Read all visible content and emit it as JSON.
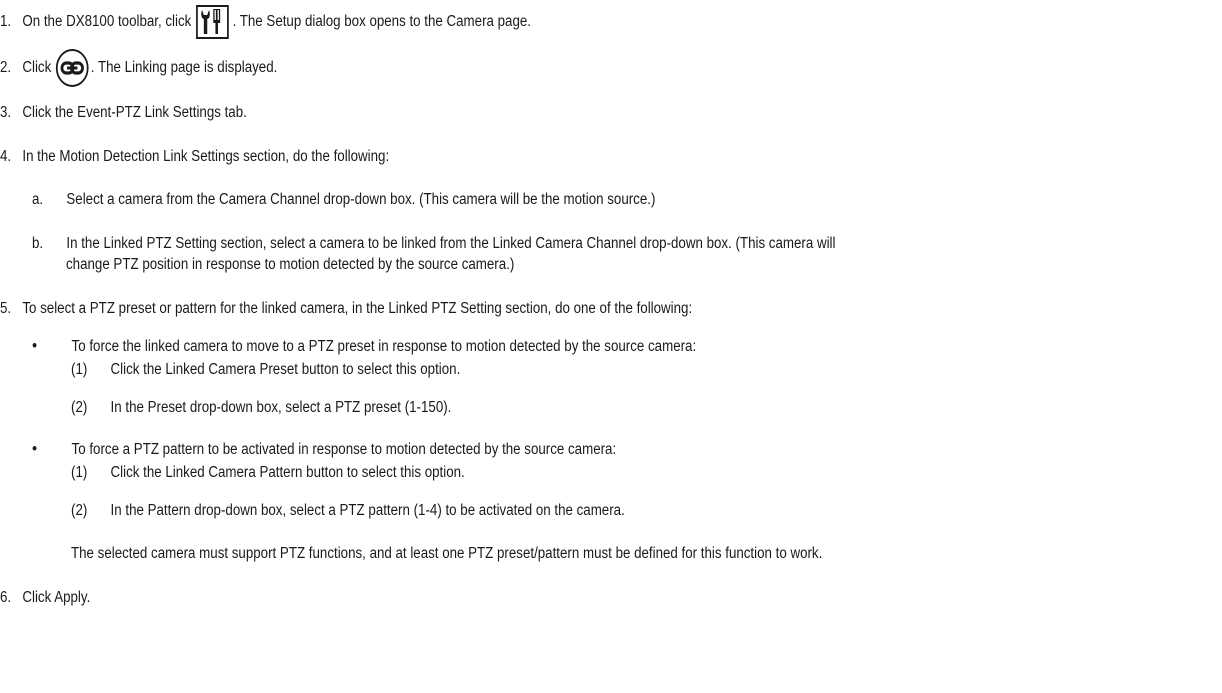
{
  "steps": [
    {
      "num": "1.",
      "before": "On the DX8100 toolbar, click",
      "icon": "tools-icon",
      "after": ". The Setup dialog box opens to the Camera page."
    },
    {
      "num": "2.",
      "before": "Click",
      "icon": "link-icon",
      "after": ". The Linking page is displayed."
    },
    {
      "num": "3.",
      "text": "Click the Event-PTZ Link Settings tab."
    },
    {
      "num": "4.",
      "text": "In the Motion Detection Link Settings section, do the following:"
    },
    {
      "num": "5.",
      "text": "To select a PTZ preset or pattern for the linked camera, in the Linked PTZ Setting section, do one of the following:"
    },
    {
      "num": "6.",
      "text": "Click Apply."
    }
  ],
  "substeps": [
    {
      "label": "a.",
      "text": "Select a camera from the Camera Channel drop-down box. (This camera will be the motion source.)"
    },
    {
      "label": "b.",
      "line1": "In the Linked PTZ Setting section, select a camera to be linked from the Linked Camera Channel drop-down box. (This camera will",
      "line2": "change PTZ position in response to motion detected by the source camera.)"
    }
  ],
  "bullets": [
    {
      "marker": "•",
      "text": "To force the linked camera to move to a PTZ preset in response to motion detected by the source camera:",
      "items": [
        {
          "label": "(1)",
          "text": "Click the Linked Camera Preset button to select this option."
        },
        {
          "label": "(2)",
          "text": "In the Preset drop-down box, select a PTZ preset (1-150)."
        }
      ]
    },
    {
      "marker": "•",
      "text": "To force a PTZ pattern to be activated in response to motion detected by the source camera:",
      "items": [
        {
          "label": "(1)",
          "text": "Click the Linked Camera Pattern button to select this option."
        },
        {
          "label": "(2)",
          "text": "In the Pattern drop-down box, select a PTZ pattern (1-4) to be activated on the camera."
        }
      ]
    }
  ],
  "note": "The selected camera must support PTZ functions, and at least one PTZ preset/pattern must be defined for this function to work."
}
